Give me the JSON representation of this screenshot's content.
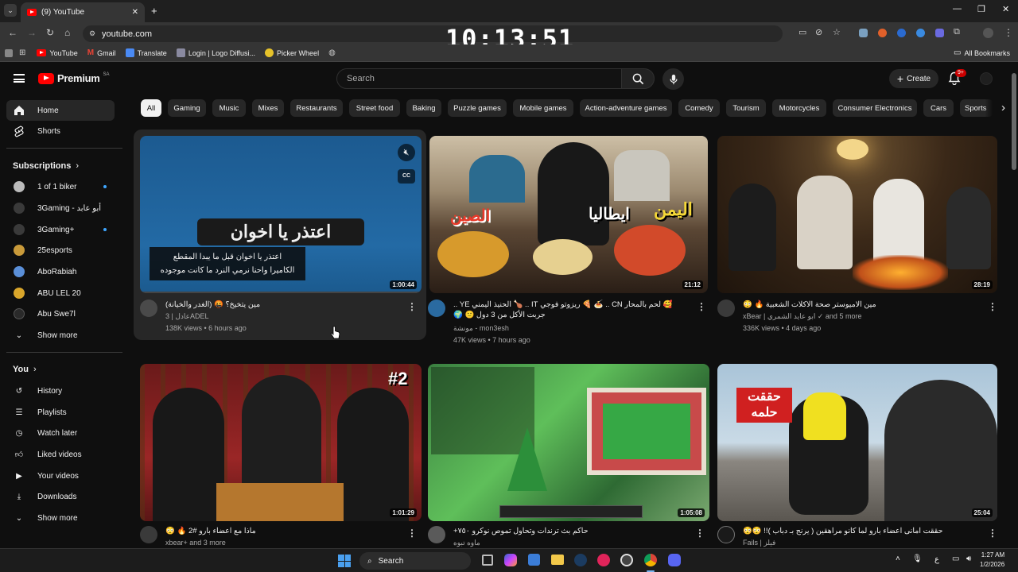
{
  "browser": {
    "tab_title": "(9) YouTube",
    "url": "youtube.com",
    "clock": "10:13:51",
    "bookmarks": [
      "YouTube",
      "Gmail",
      "Translate",
      "Login | Logo Diffusi...",
      "Picker Wheel"
    ],
    "all_bookmarks": "All Bookmarks"
  },
  "masthead": {
    "logo": "Premium",
    "region": "SA",
    "search_placeholder": "Search",
    "create_label": "Create",
    "notif_badge": "9+"
  },
  "sidebar": {
    "home": "Home",
    "shorts": "Shorts",
    "subs_heading": "Subscriptions",
    "subscriptions": [
      {
        "name": "1 of 1 biker",
        "color": "#bbbbbb",
        "live": true
      },
      {
        "name": "3Gaming - أبو عابد",
        "color": "#3a3a3a",
        "live": false
      },
      {
        "name": "3Gaming+",
        "color": "#3a3a3a",
        "live": true
      },
      {
        "name": "25esports",
        "color": "#c99a3a",
        "live": false
      },
      {
        "name": "AboRabiah",
        "color": "#5a8fd8",
        "live": false
      },
      {
        "name": "ABU LEL 20",
        "color": "#d9a62b",
        "live": false
      },
      {
        "name": "Abu Swe7l",
        "color": "#2a2a2a",
        "live": false
      }
    ],
    "show_more": "Show more",
    "you_heading": "You",
    "you_items": [
      "History",
      "Playlists",
      "Watch later",
      "Liked videos",
      "Your videos",
      "Downloads",
      "Show more"
    ]
  },
  "chips": [
    "All",
    "Gaming",
    "Music",
    "Mixes",
    "Restaurants",
    "Street food",
    "Baking",
    "Puzzle games",
    "Mobile games",
    "Action-adventure games",
    "Comedy",
    "Tourism",
    "Motorcycles",
    "Consumer Electronics",
    "Cars",
    "Sports"
  ],
  "videos": [
    {
      "title": "مين يتخيخ؟ 🤬 (الغدر والخيانة)",
      "channel": "عادل | 3ADEL",
      "stats": "138K views • 6 hours ago",
      "duration": "1:00:44",
      "caption_line1": "اعتذر يا اخوان قبل ما يبدا المقطع",
      "caption_line2": "الكاميرا واحنا نرمي النرد ما كانت موجوده",
      "big_text": "اعتذر يا اخوان",
      "cc": "CC",
      "bg": "#1f5d95"
    },
    {
      "title": "🥰 لحم بالمحار CN .. 🍝 🍕 ريزوتو فوجي IT .. 🍗 الحنيذ اليمني YE .. جربت الأكل من 3 دول 🙂 🌍",
      "channel": "مونشة - mon3esh",
      "stats": "47K views • 7 hours ago",
      "duration": "21:12",
      "label_yemen": "اليمن",
      "label_italy": "ايطاليا",
      "label_china": "الصين",
      "bg": "#6a5a48"
    },
    {
      "title": "مين الاميوستر صحة الاكلات الشعبية 🔥 😳",
      "channel": "xBear | ابو عايد الشمري",
      "channel_extra": "and 5 more",
      "stats": "336K views • 4 days ago",
      "duration": "28:19",
      "bg": "#3a2a1e"
    },
    {
      "title": "ماذا مع اعضاء بارو #2 🔥 😳",
      "channel": "xbear+ and 3 more",
      "stats": "",
      "duration": "1:01:29",
      "badge": "#2",
      "bg": "#8a2020"
    },
    {
      "title": "حاكم بث ترندات وتحاول تموص نوكرو ٧٥٠+",
      "channel": "ماوه تبوه",
      "stats": "",
      "duration": "1:05:08",
      "bg": "#2e7a3a"
    },
    {
      "title": "حققت امانى اعضاء بارو لما كانو مراهقين ( يرنج بـ دباب )!! 😳😳",
      "channel": "Fails | فيلز",
      "stats": "",
      "duration": "25:04",
      "thumb_text": "حققت حلمه",
      "bg": "#8fb0c8"
    }
  ],
  "taskbar": {
    "search": "Search",
    "time": "1:27 AM",
    "date": "1/2/2026",
    "lang": "ع"
  }
}
